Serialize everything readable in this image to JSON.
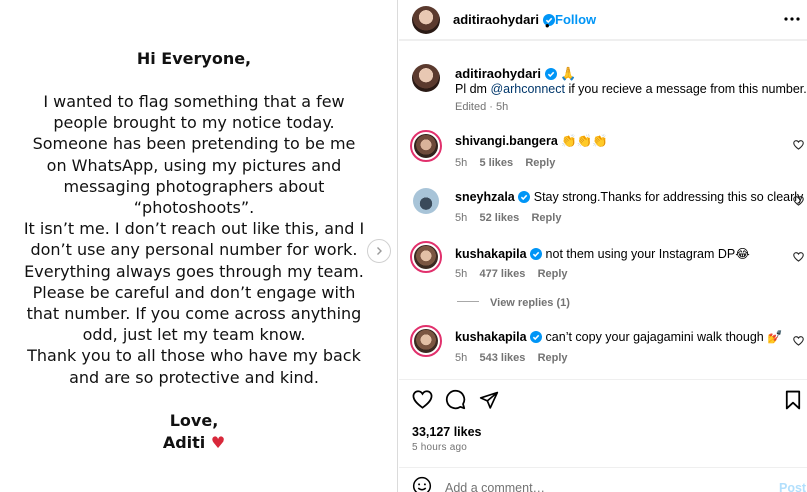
{
  "post_image": {
    "greeting": "Hi Everyone,",
    "lines": [
      "I wanted to flag something that a few",
      "people brought to my notice today.",
      "Someone has been pretending to be me",
      "on WhatsApp, using my pictures and",
      "messaging photographers about",
      "“photoshoots”.",
      "It isn’t me. I don’t reach out like this, and I",
      "don’t use any personal number for work.",
      "Everything always goes through my team.",
      "Please be careful and don’t engage with",
      "that number. If you come across anything",
      "odd, just let my team know.",
      "Thank you to all those who have my back",
      "and are so protective and kind."
    ],
    "signoff": "Love,",
    "signature": "Aditi",
    "heart": "♥"
  },
  "header": {
    "username": "aditiraohydari",
    "dot": "•",
    "follow": "Follow"
  },
  "caption": {
    "username": "aditiraohydari",
    "emoji": "🙏",
    "text_before": "Pl dm ",
    "mention": "@arhconnect",
    "text_after": " if you recieve a message from this number.",
    "meta": "Edited · 5h"
  },
  "comments": [
    {
      "user": "shivangi.bangera",
      "text": "👏👏👏",
      "time": "5h",
      "likes": "5 likes",
      "reply": "Reply"
    },
    {
      "user": "sneyhzala",
      "text": "Stay strong.Thanks for addressing this so clearly",
      "time": "5h",
      "likes": "52 likes",
      "reply": "Reply"
    },
    {
      "user": "kushakapila",
      "text": "not them using your Instagram DP😂",
      "time": "5h",
      "likes": "477 likes",
      "reply": "Reply"
    },
    {
      "user": "kushakapila",
      "text": "can’t copy your gajagamini walk though 💅",
      "time": "5h",
      "likes": "543 likes",
      "reply": "Reply"
    }
  ],
  "view_replies": "View replies (1)",
  "likes": "33,127 likes",
  "time_ago": "5 hours ago",
  "add_comment_placeholder": "Add a comment…",
  "post_label": "Post",
  "colors": {
    "accent": "#0095f6",
    "verified": "#0095f6",
    "muted": "#737373"
  }
}
